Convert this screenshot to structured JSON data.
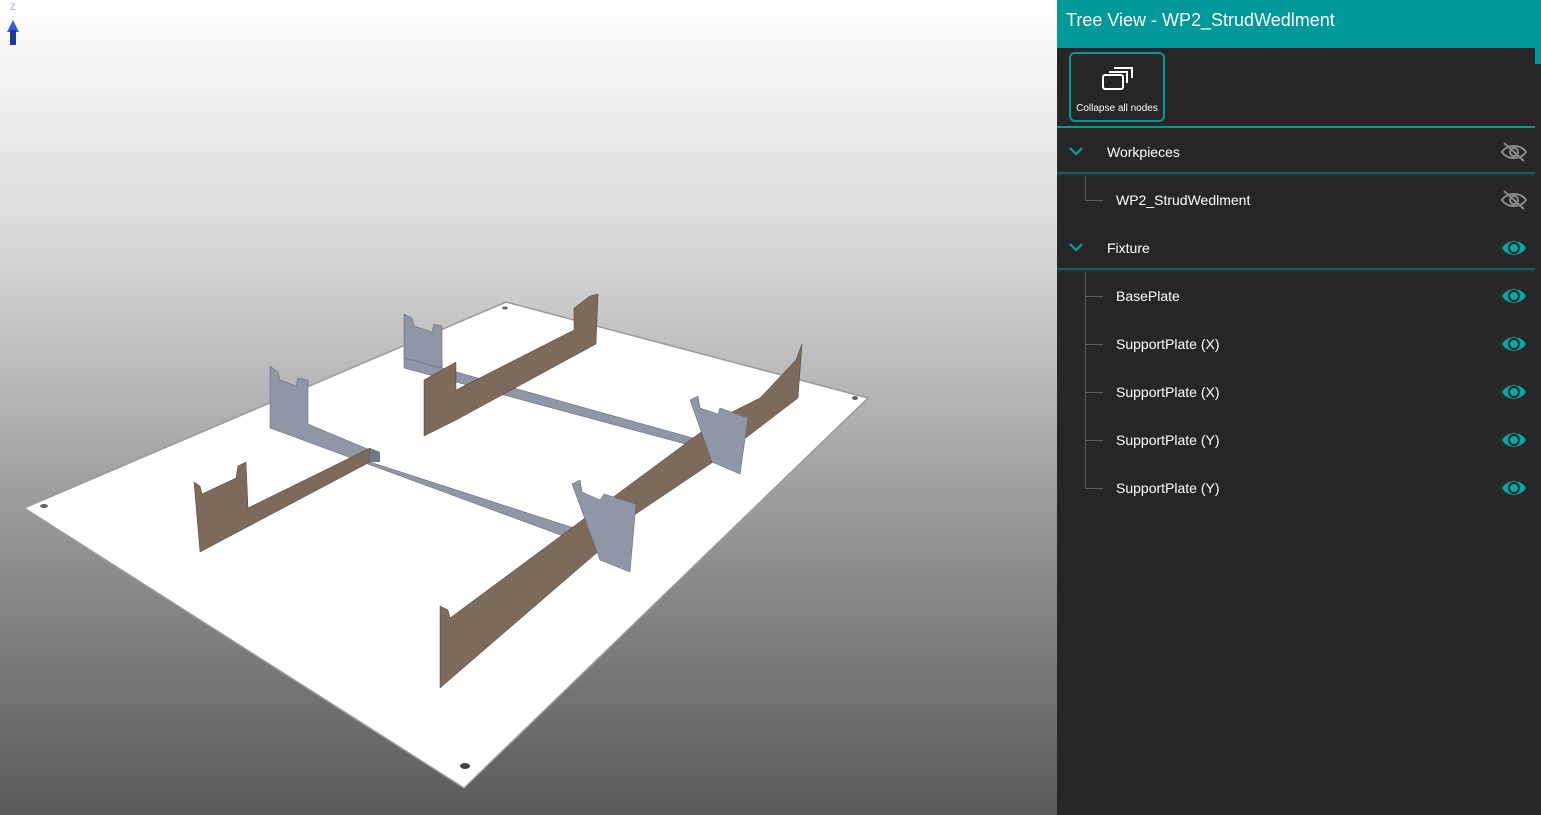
{
  "panel": {
    "title": "Tree View - WP2_StrudWedlment",
    "toolbar": {
      "collapse_label": "Collapse all nodes",
      "collapse_icon": "collapse-all-icon"
    }
  },
  "tree": {
    "nodes": [
      {
        "label": "Workpieces",
        "type": "group",
        "visible": false
      },
      {
        "label": "WP2_StrudWedlment",
        "type": "child",
        "visible": false
      },
      {
        "label": "Fixture",
        "type": "group",
        "visible": true
      },
      {
        "label": "BasePlate",
        "type": "child",
        "visible": true
      },
      {
        "label": "SupportPlate (X)",
        "type": "child",
        "visible": true
      },
      {
        "label": "SupportPlate (X)",
        "type": "child",
        "visible": true
      },
      {
        "label": "SupportPlate (Y)",
        "type": "child",
        "visible": true
      },
      {
        "label": "SupportPlate (Y)",
        "type": "child",
        "visible": true
      }
    ]
  },
  "viewport": {
    "axis_label": "Z"
  },
  "colors": {
    "accent": "#009999",
    "panel_bg": "#262626",
    "hidden_icon": "#8a8a8a",
    "visible_icon": "#00a7a7",
    "plate_x": "#7c6b5a",
    "plate_y": "#8f96a6"
  }
}
